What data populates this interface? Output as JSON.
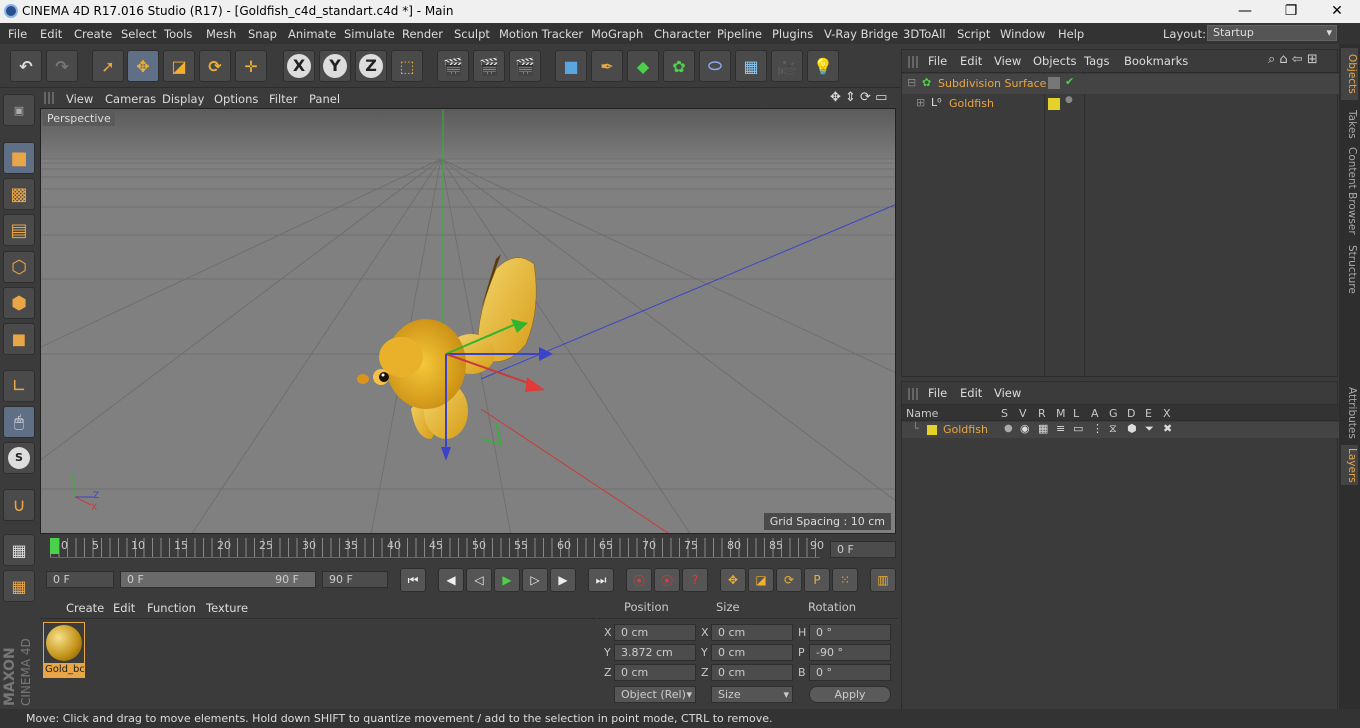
{
  "window": {
    "title": "CINEMA 4D R17.016 Studio (R17) - [Goldfish_c4d_standart.c4d *] - Main",
    "minimize": "—",
    "maximize": "❐",
    "close": "✕"
  },
  "menubar": {
    "items": [
      "File",
      "Edit",
      "Create",
      "Select",
      "Tools",
      "Mesh",
      "Snap",
      "Animate",
      "Simulate",
      "Render",
      "Sculpt",
      "Motion Tracker",
      "MoGraph",
      "Character",
      "Pipeline",
      "Plugins",
      "V-Ray Bridge",
      "3DToAll",
      "Script",
      "Window",
      "Help"
    ],
    "layout_label": "Layout:",
    "layout_value": "Startup"
  },
  "toolbar": {
    "axis_x": "X",
    "axis_y": "Y",
    "axis_z": "Z"
  },
  "viewport": {
    "menu": [
      "View",
      "Cameras",
      "Display",
      "Options",
      "Filter",
      "Panel"
    ],
    "label": "Perspective",
    "grid_spacing": "Grid Spacing : 10 cm",
    "axis_y": "Y",
    "axis_x": "X",
    "axis_z": "Z"
  },
  "timeline": {
    "ticks": [
      "0",
      "5",
      "10",
      "15",
      "20",
      "25",
      "30",
      "35",
      "40",
      "45",
      "50",
      "55",
      "60",
      "65",
      "70",
      "75",
      "80",
      "85",
      "90"
    ],
    "current_frame": "0 F"
  },
  "transport": {
    "start": "0 F",
    "range_start": "0 F",
    "range_end": "90 F",
    "end": "90 F"
  },
  "material_manager": {
    "menu": [
      "Create",
      "Edit",
      "Function",
      "Texture"
    ],
    "material_name": "Gold_bc"
  },
  "coordinates": {
    "headers": [
      "Position",
      "Size",
      "Rotation"
    ],
    "rows": [
      {
        "axis": "X",
        "pos": "0 cm",
        "size_axis": "X",
        "size": "0 cm",
        "rot_axis": "H",
        "rot": "0 °"
      },
      {
        "axis": "Y",
        "pos": "3.872 cm",
        "size_axis": "Y",
        "size": "0 cm",
        "rot_axis": "P",
        "rot": "-90 °"
      },
      {
        "axis": "Z",
        "pos": "0 cm",
        "size_axis": "Z",
        "size": "0 cm",
        "rot_axis": "B",
        "rot": "0 °"
      }
    ],
    "mode": "Object (Rel)",
    "size_mode": "Size",
    "apply": "Apply"
  },
  "object_manager": {
    "menu": [
      "File",
      "Edit",
      "View",
      "Objects",
      "Tags",
      "Bookmarks"
    ],
    "objects": [
      "Subdivision Surface",
      "Goldfish"
    ]
  },
  "layer_manager": {
    "menu": [
      "File",
      "Edit",
      "View"
    ],
    "columns": [
      "Name",
      "S",
      "V",
      "R",
      "M",
      "L",
      "A",
      "G",
      "D",
      "E",
      "X"
    ],
    "layer_name": "Goldfish"
  },
  "side_tabs": [
    "Objects",
    "Takes",
    "Content Browser",
    "Structure",
    "Attributes",
    "Layers"
  ],
  "status": "Move: Click and drag to move elements. Hold down SHIFT to quantize movement / add to the selection in point mode, CTRL to remove.",
  "brand": {
    "maxon": "MAXON",
    "product": "CINEMA 4D"
  },
  "colors": {
    "accent": "#e8a646",
    "layer_yellow": "#e2d22a",
    "active_tool": "#5e6f86"
  }
}
